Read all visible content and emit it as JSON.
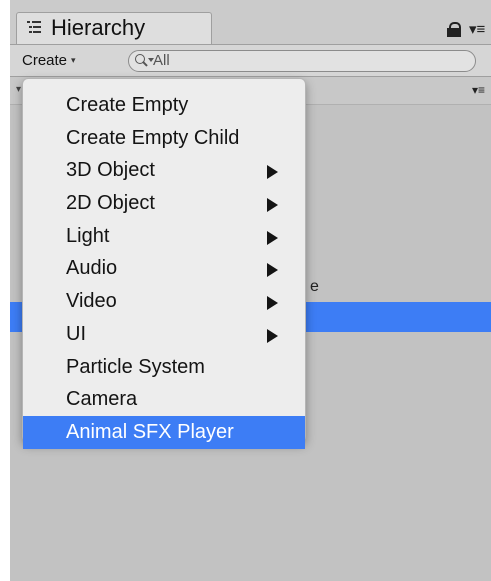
{
  "window": {
    "tab_title": "Hierarchy",
    "tab_icon": "hierarchy-list-icon",
    "lock_icon": "lock-icon",
    "tab_menu_icon": "context-menu-icon"
  },
  "toolbar": {
    "create_label": "Create",
    "create_caret": "▾",
    "search_value": "All",
    "search_icon": "search-icon"
  },
  "scene_row": {
    "menu_glyph": "▾≡"
  },
  "tab_menu_glyph": "▾≡",
  "menu": {
    "items": [
      {
        "label": "Create Empty",
        "has_submenu": false
      },
      {
        "label": "Create Empty Child",
        "has_submenu": false
      },
      {
        "label": "3D Object",
        "has_submenu": true
      },
      {
        "label": "2D Object",
        "has_submenu": true
      },
      {
        "label": "Light",
        "has_submenu": true
      },
      {
        "label": "Audio",
        "has_submenu": true
      },
      {
        "label": "Video",
        "has_submenu": true
      },
      {
        "label": "UI",
        "has_submenu": true
      },
      {
        "label": "Particle System",
        "has_submenu": false
      },
      {
        "label": "Camera",
        "has_submenu": false
      },
      {
        "label": "Animal SFX Player",
        "has_submenu": false,
        "highlighted": true
      }
    ]
  },
  "background_partial_text": "e",
  "colors": {
    "selection_blue": "#3d7df5",
    "panel_gray": "#c2c2c2",
    "menu_bg": "#ededed"
  }
}
